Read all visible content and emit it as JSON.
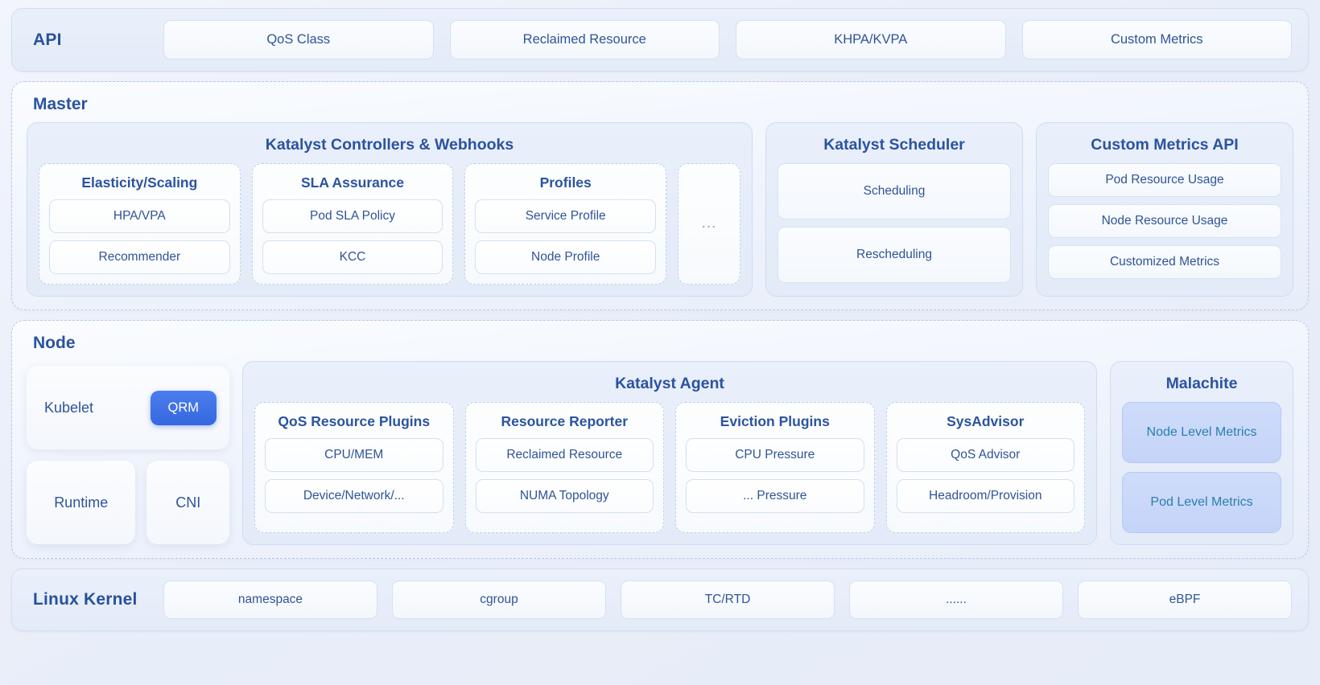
{
  "api": {
    "title": "API",
    "items": [
      "QoS Class",
      "Reclaimed Resource",
      "KHPA/KVPA",
      "Custom Metrics"
    ]
  },
  "master": {
    "title": "Master",
    "controllers": {
      "title": "Katalyst Controllers & Webhooks",
      "groups": [
        {
          "title": "Elasticity/Scaling",
          "items": [
            "HPA/VPA",
            "Recommender"
          ]
        },
        {
          "title": "SLA Assurance",
          "items": [
            "Pod SLA Policy",
            "KCC"
          ]
        },
        {
          "title": "Profiles",
          "items": [
            "Service Profile",
            "Node Profile"
          ]
        }
      ],
      "more": "..."
    },
    "scheduler": {
      "title": "Katalyst Scheduler",
      "items": [
        "Scheduling",
        "Rescheduling"
      ]
    },
    "metrics_api": {
      "title": "Custom Metrics API",
      "items": [
        "Pod Resource Usage",
        "Node Resource Usage",
        "Customized Metrics"
      ]
    }
  },
  "node": {
    "title": "Node",
    "kubelet": {
      "label": "Kubelet",
      "badge": "QRM"
    },
    "runtime": "Runtime",
    "cni": "CNI",
    "agent": {
      "title": "Katalyst Agent",
      "groups": [
        {
          "title": "QoS Resource Plugins",
          "items": [
            "CPU/MEM",
            "Device/Network/..."
          ]
        },
        {
          "title": "Resource Reporter",
          "items": [
            "Reclaimed Resource",
            "NUMA Topology"
          ]
        },
        {
          "title": "Eviction Plugins",
          "items": [
            "CPU Pressure",
            "... Pressure"
          ]
        },
        {
          "title": "SysAdvisor",
          "items": [
            "QoS Advisor",
            "Headroom/Provision"
          ]
        }
      ]
    },
    "malachite": {
      "title": "Malachite",
      "items": [
        "Node Level Metrics",
        "Pod Level Metrics"
      ]
    }
  },
  "kernel": {
    "title": "Linux Kernel",
    "items": [
      "namespace",
      "cgroup",
      "TC/RTD",
      "......",
      "eBPF"
    ]
  },
  "colors": {
    "accent": "#2b539f",
    "badge": "#3568df",
    "malachite_text": "#2a7fad",
    "malachite_bg": "#c9d8fa"
  }
}
